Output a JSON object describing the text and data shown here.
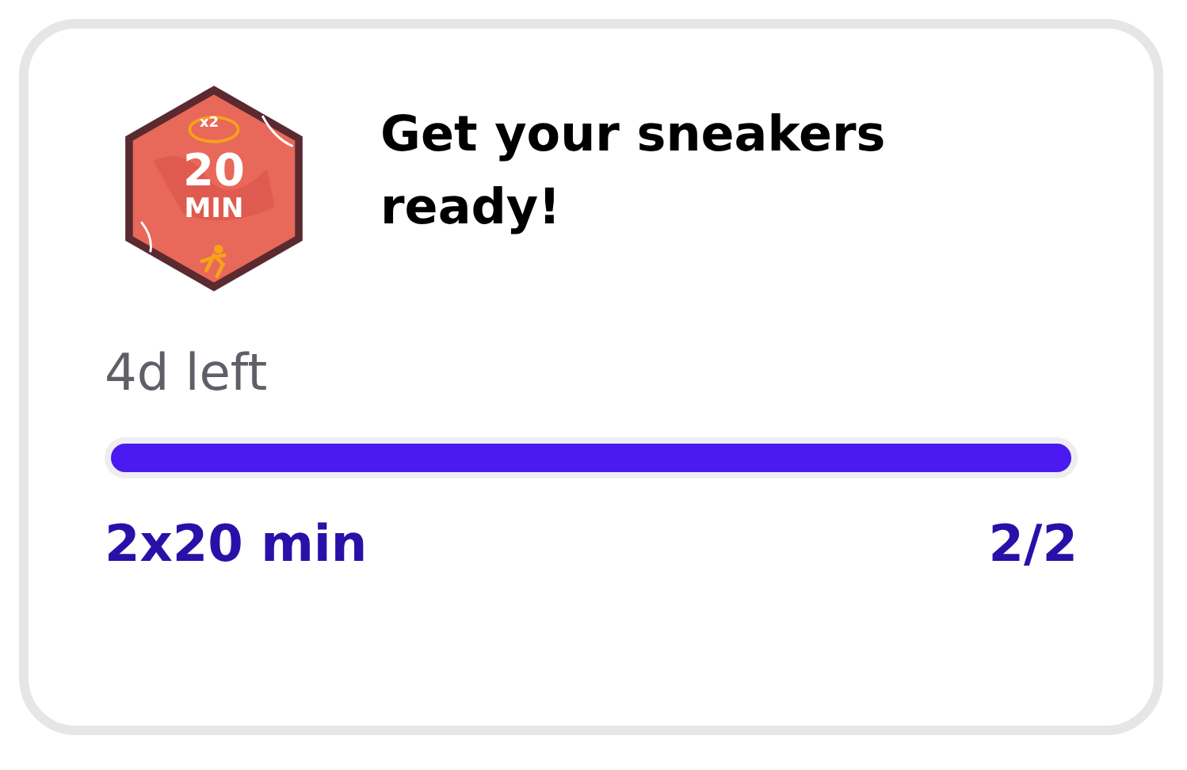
{
  "badge": {
    "multiplier": "x2",
    "value": "20",
    "unit": "MIN"
  },
  "title": "Get your sneakers ready!",
  "time_left": "4d left",
  "progress": {
    "level": 1
  },
  "goal": "2x20 min",
  "count": "2/2"
}
